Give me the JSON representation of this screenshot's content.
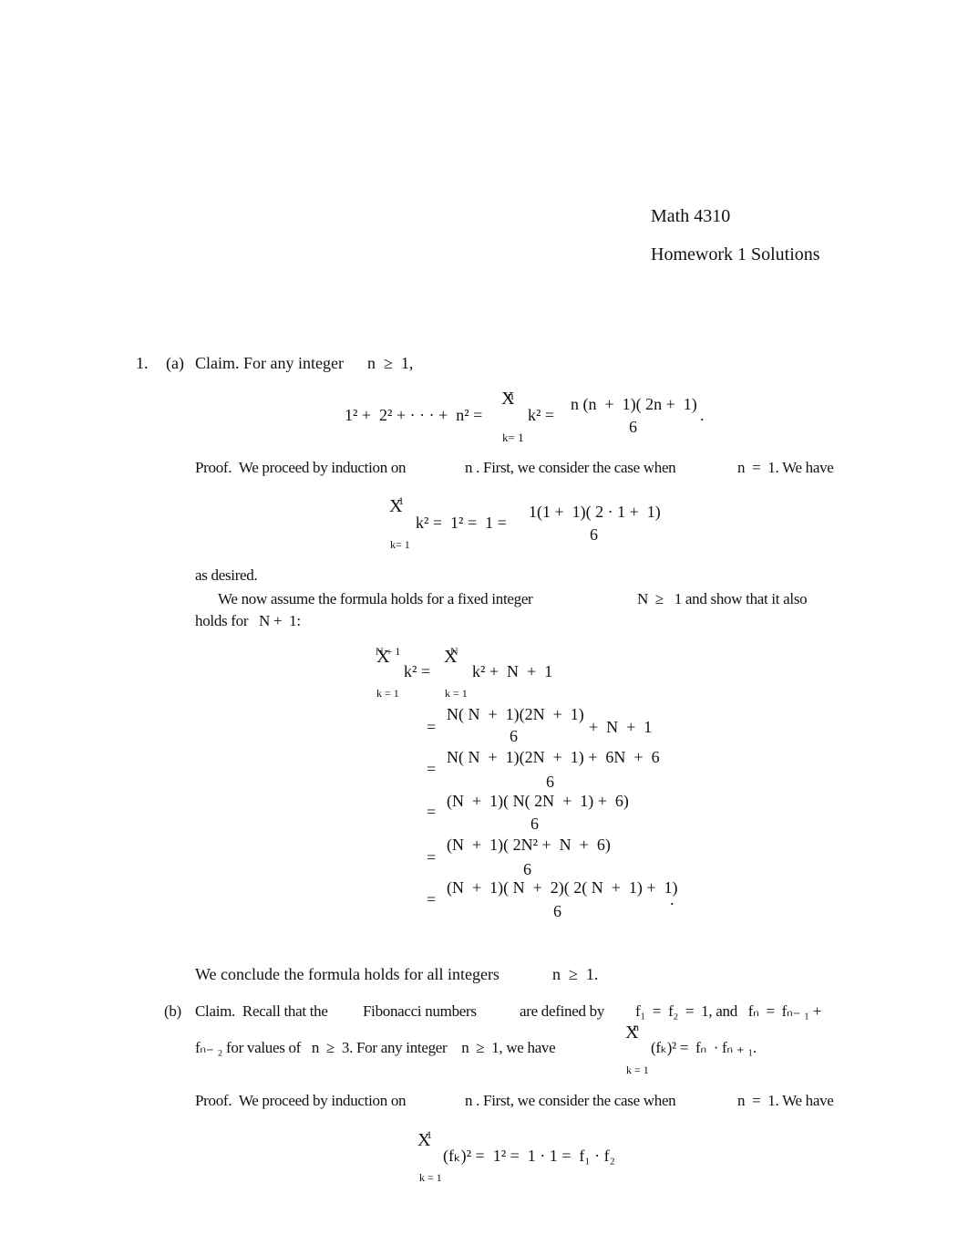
{
  "header": {
    "course": "Math 4310",
    "title": "Homework 1 Solutions"
  },
  "problem1": {
    "number": "1.",
    "part_a": {
      "label": "(a)",
      "claim_text": "Claim. For any integer",
      "claim_cond": "n  ≥  1,",
      "eq1": {
        "lhs": "1² +  2² + · · · +  n² =",
        "sigma": "X",
        "sigma_upper": "n",
        "sigma_lower": "k= 1",
        "summand": "k² =",
        "numerator": "n (n  +  1)( 2n +  1)",
        "denominator": "6",
        "trail": "."
      },
      "proof_line": {
        "p1": "Proof.  We proceed by induction on",
        "p2": "n . First, we consider the case when",
        "p3": "n  =  1. We have"
      },
      "base_eq": {
        "sigma": "X",
        "sigma_upper": "1",
        "sigma_lower": "k= 1",
        "body": "k² =  1² =  1 =",
        "numerator": "1(1 +  1)( 2 · 1 +  1)",
        "denominator": "6"
      },
      "as_desired": "as desired.",
      "induction_1": "We now assume the formula holds for a fixed integer",
      "induction_cond": "N  ≥   1 and show that it also",
      "induction_2": "holds for   N +  1:",
      "chain": {
        "lhs_sigma": "X",
        "lhs_upper": "N + 1",
        "lhs_lower": "k = 1",
        "lhs_summand": "k² =",
        "rhs_sigma": "X",
        "rhs_upper": "N",
        "rhs_lower": "k = 1",
        "rhs_body": "k² +  N  +  1",
        "steps": [
          {
            "eq": "=",
            "numerator": "N( N  +  1)(2N  +  1)",
            "denominator": "6",
            "trail": "+  N  +  1"
          },
          {
            "eq": "=",
            "numerator": "N( N  +  1)(2N  +  1) +  6N  +  6",
            "denominator": "6",
            "trail": ""
          },
          {
            "eq": "=",
            "numerator": "(N  +  1)( N( 2N  +  1) +  6)",
            "denominator": "6",
            "trail": ""
          },
          {
            "eq": "=",
            "numerator": "(N  +  1)( 2N² +  N  +  6)",
            "denominator": "6",
            "trail": ""
          },
          {
            "eq": "=",
            "numerator": "(N  +  1)( N  +  2)( 2( N  +  1) +  1)",
            "denominator": "6",
            "trail": "."
          }
        ]
      },
      "conclusion": "We conclude the formula holds for all integers",
      "conclusion_cond": "n  ≥  1."
    },
    "part_b": {
      "label": "(b)",
      "line1_a": "Claim.  Recall that the",
      "line1_term": "Fibonacci numbers",
      "line1_b": "are defined by",
      "line1_def": "f₁  =  f₂  =  1, and   fₙ  =  fₙ₋ ₁ +",
      "line2_a": "fₙ₋ ₂ for values of   n  ≥  3. For any integer    n  ≥  1, we have",
      "line2_sigma": "X",
      "line2_upper": "n",
      "line2_lower": "k = 1",
      "line2_body": "(fₖ)² =  fₙ  · fₙ ₊ ₁.",
      "proof_line": {
        "p1": "Proof.  We proceed by induction on",
        "p2": "n . First, we consider the case when",
        "p3": "n  =  1. We have"
      },
      "base_eq": {
        "sigma": "X",
        "sigma_upper": "1",
        "sigma_lower": "k = 1",
        "body": "(fₖ)² =  1² =  1 · 1 =  f₁ · f₂"
      }
    }
  }
}
